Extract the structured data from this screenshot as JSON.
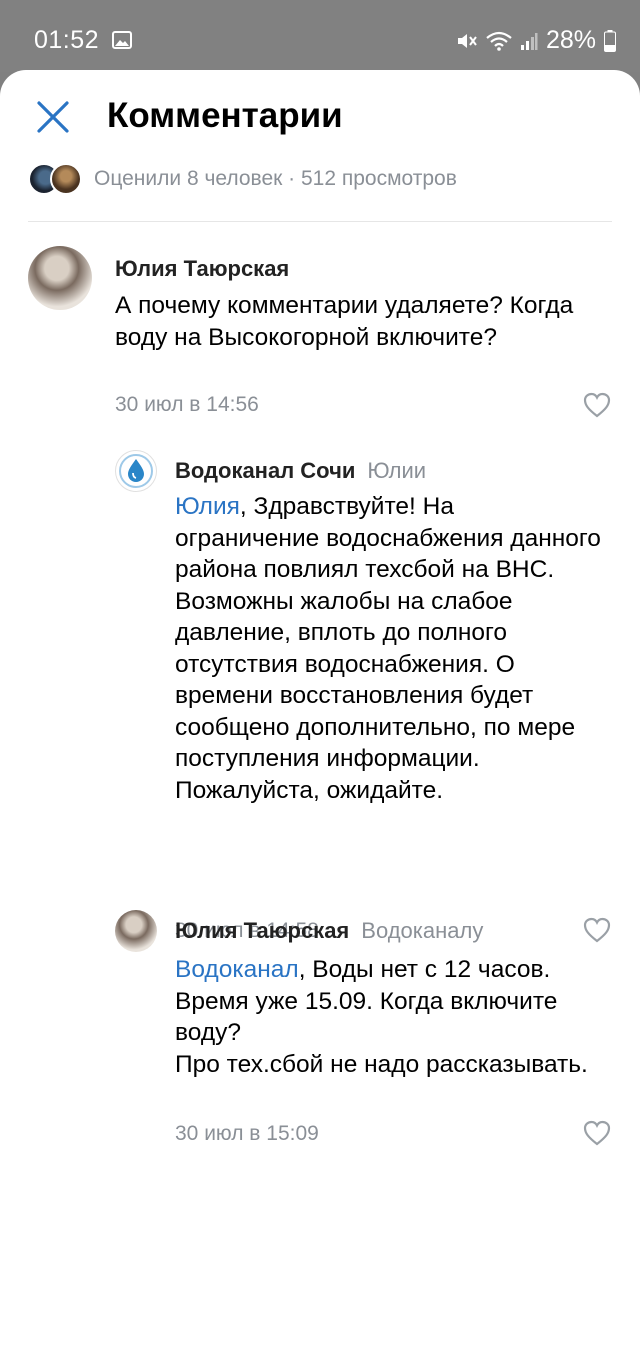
{
  "status_bar": {
    "time": "01:52",
    "battery": "28%"
  },
  "header": {
    "title": "Комментарии",
    "close_icon": "close-icon"
  },
  "likes": {
    "text": "Оценили 8 человек · 512 просмотров"
  },
  "comments": [
    {
      "author": "Юлия Таюрская",
      "reply_to": "",
      "mention": "",
      "text": "А почему комментарии удаляете? Когда воду на Высокогорной включите?",
      "date": "30 июл в 14:56"
    },
    {
      "author": "Водоканал Сочи",
      "reply_to": "Юлии",
      "mention": "Юлия",
      "text": ", Здравствуйте! На ограничение водоснабжения данного района повлиял техсбой на ВНС. Возможны жалобы на слабое давление, вплоть до полного отсутствия водоснабжения. О времени восстановления будет сообщено дополнительно, по мере поступления информации. Пожалуйста, ожидайте.",
      "date": "30 июл в 14:58"
    },
    {
      "author": "Юлия Таюрская",
      "reply_to": "Водоканалу",
      "mention": "Водоканал",
      "text": ", Воды нет с 12 часов. Время уже 15.09. Когда включите воду?\nПро тех.сбой не надо рассказывать.",
      "date": "30 июл в 15:09"
    }
  ],
  "colors": {
    "accent": "#2a74c4",
    "secondary_text": "#8a8f96"
  }
}
